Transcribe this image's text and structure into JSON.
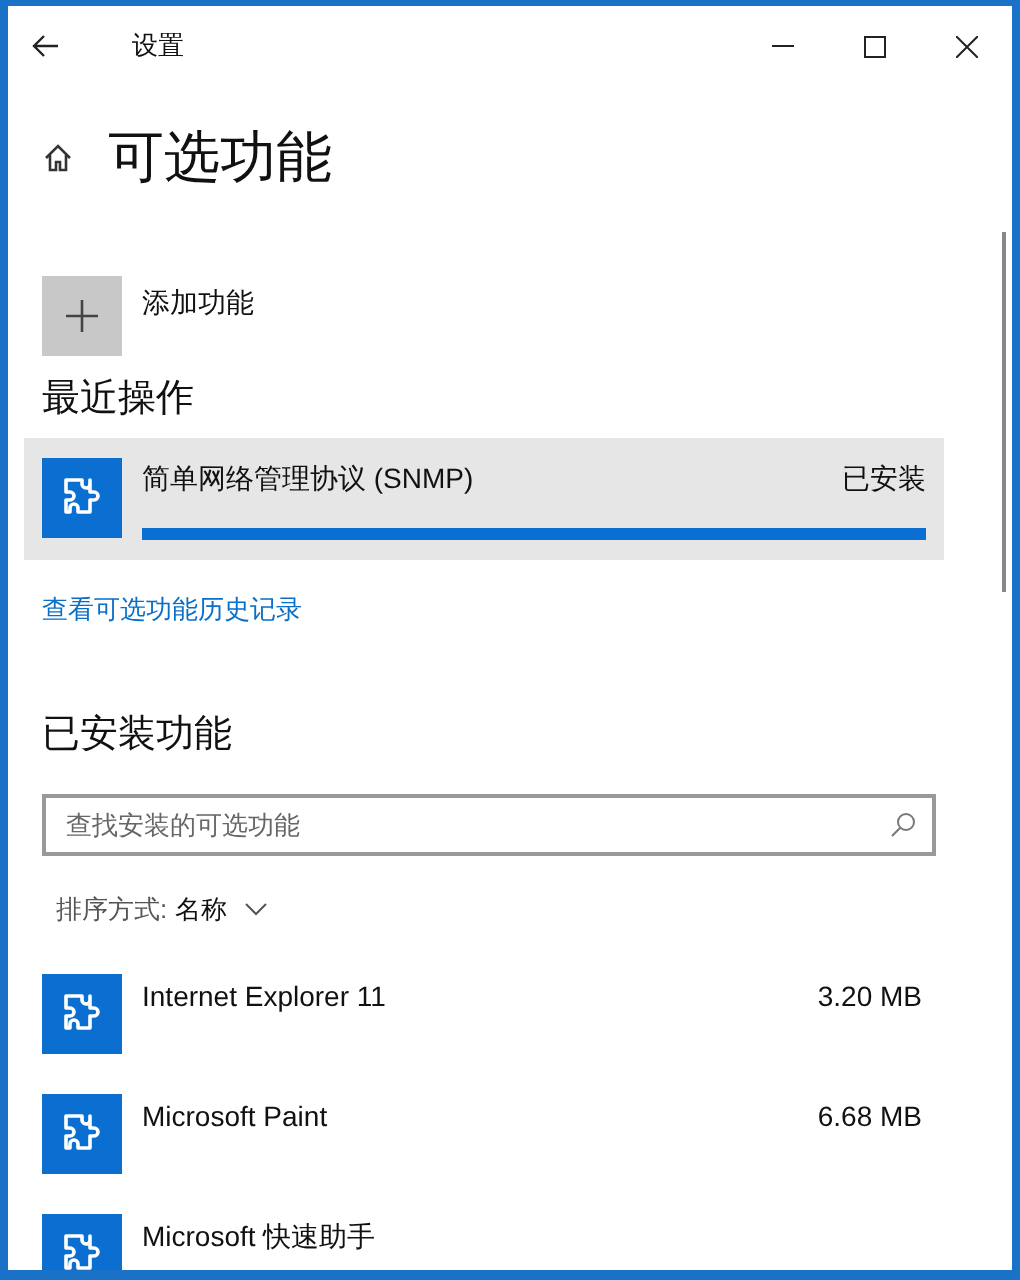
{
  "window": {
    "title": "设置"
  },
  "page": {
    "title": "可选功能"
  },
  "add_feature": {
    "label": "添加功能"
  },
  "recent": {
    "heading": "最近操作",
    "items": [
      {
        "name": "简单网络管理协议 (SNMP)",
        "status": "已安装",
        "level": 1
      }
    ]
  },
  "history_link": "查看可选功能历史记录",
  "installed": {
    "heading": "已安装功能",
    "search": {
      "placeholder": "查找安装的可选功能"
    },
    "sort": {
      "label": "排序方式:",
      "value": "名称"
    },
    "items": [
      {
        "name": "Internet Explorer 11",
        "size": "3.20 MB"
      },
      {
        "name": "Microsoft Paint",
        "size": "6.68 MB"
      },
      {
        "name": "Microsoft 快速助手"
      }
    ]
  }
}
